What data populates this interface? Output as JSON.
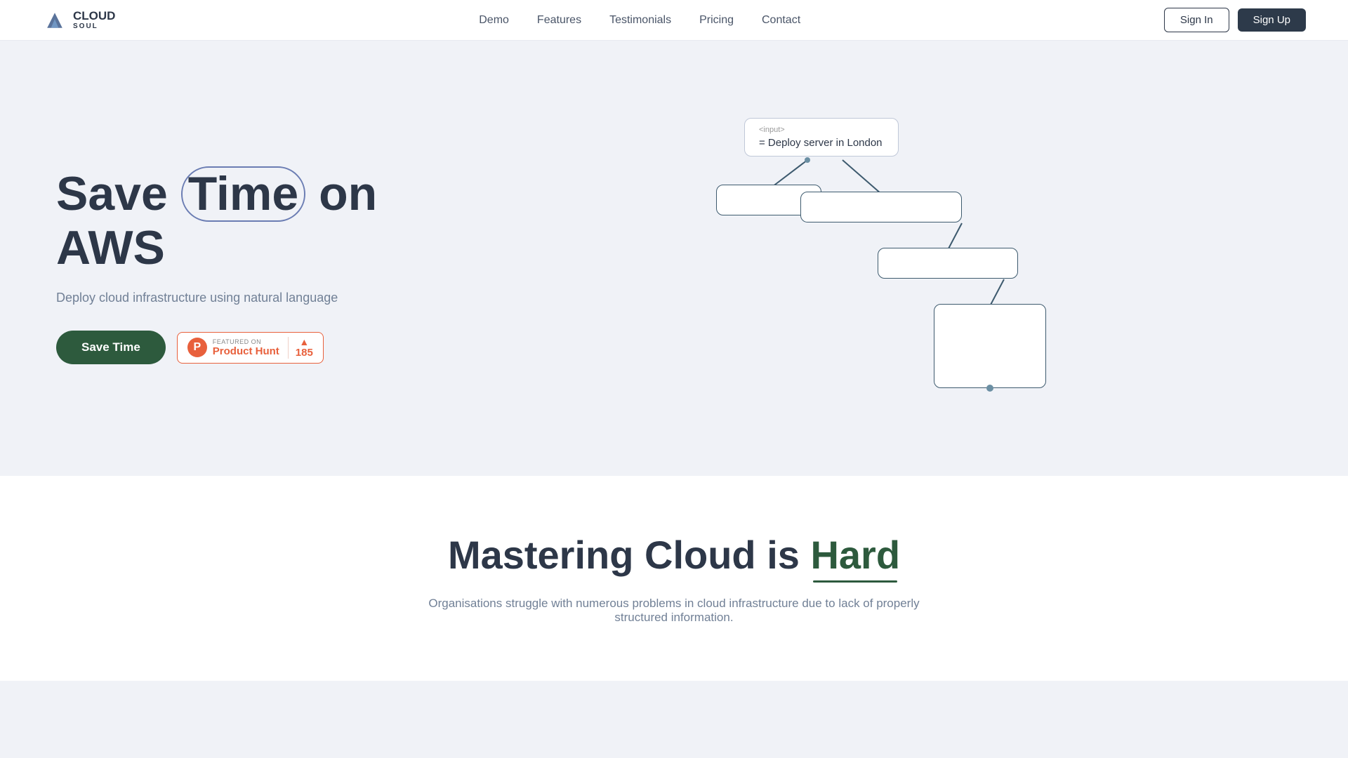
{
  "navbar": {
    "logo_name": "CLOUD",
    "logo_sub": "SOUL",
    "nav_items": [
      {
        "label": "Demo",
        "href": "#"
      },
      {
        "label": "Features",
        "href": "#"
      },
      {
        "label": "Testimonials",
        "href": "#"
      },
      {
        "label": "Pricing",
        "href": "#"
      },
      {
        "label": "Contact",
        "href": "#"
      }
    ],
    "signin_label": "Sign In",
    "signup_label": "Sign Up"
  },
  "hero": {
    "title_pre": "Save",
    "title_highlight": "Time",
    "title_post": "on AWS",
    "subtitle": "Deploy cloud infrastructure using natural language",
    "cta_label": "Save Time",
    "product_hunt": {
      "featured_label": "FEATURED ON",
      "name": "Product Hunt",
      "count": "185"
    },
    "diagram": {
      "input_label": "<input>",
      "input_content": "= Deploy server in London"
    }
  },
  "section_hard": {
    "title_pre": "Mastering Cloud is",
    "title_hard": "Hard",
    "subtitle": "Organisations struggle with numerous problems in cloud infrastructure due to lack of properly structured information."
  }
}
